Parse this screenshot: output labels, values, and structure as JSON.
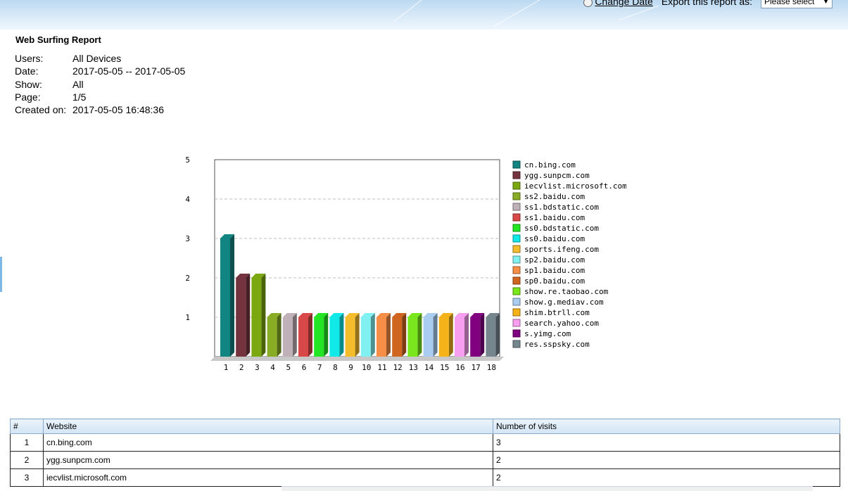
{
  "header": {
    "change_date_label": "Change Date",
    "export_label": "Export this report as:",
    "export_select_value": "Please select"
  },
  "report": {
    "title": "Web Surfing Report",
    "meta": [
      {
        "label": "Users:",
        "value": "All Devices"
      },
      {
        "label": "Date:",
        "value": "2017-05-05 -- 2017-05-05"
      },
      {
        "label": "Show:",
        "value": "All"
      },
      {
        "label": "Page:",
        "value": "1/5"
      },
      {
        "label": "Created on:",
        "value": "2017-05-05 16:48:36"
      }
    ]
  },
  "chart_data": {
    "type": "bar",
    "categories": [
      "1",
      "2",
      "3",
      "4",
      "5",
      "6",
      "7",
      "8",
      "9",
      "10",
      "11",
      "12",
      "13",
      "14",
      "15",
      "16",
      "17",
      "18"
    ],
    "values": [
      3,
      2,
      2,
      1,
      1,
      1,
      1,
      1,
      1,
      1,
      1,
      1,
      1,
      1,
      1,
      1,
      1,
      1
    ],
    "legend": [
      "cn.bing.com",
      "ygg.sunpcm.com",
      "iecvlist.microsoft.com",
      "ss2.baidu.com",
      "ss1.bdstatic.com",
      "ss1.baidu.com",
      "ss0.bdstatic.com",
      "ss0.baidu.com",
      "sports.ifeng.com",
      "sp2.baidu.com",
      "sp1.baidu.com",
      "sp0.baidu.com",
      "show.re.taobao.com",
      "show.g.mediav.com",
      "shim.btrll.com",
      "search.yahoo.com",
      "s.yimg.com",
      "res.sspsky.com"
    ],
    "colors": [
      "#128583",
      "#74333e",
      "#7ba711",
      "#88ac24",
      "#bfb1b7",
      "#d94848",
      "#22e623",
      "#11e8e8",
      "#f5bd2c",
      "#80f0f0",
      "#f68e48",
      "#d06520",
      "#7ae61c",
      "#a9cdf1",
      "#f5b319",
      "#f89ef0",
      "#800080",
      "#76868e"
    ],
    "yticks": [
      1,
      2,
      3,
      4,
      5
    ],
    "ylim": [
      0,
      5
    ],
    "grid": true,
    "legend_position": "right"
  },
  "table": {
    "headers": [
      "#",
      "Website",
      "Number of visits"
    ],
    "rows": [
      [
        "1",
        "cn.bing.com",
        "3"
      ],
      [
        "2",
        "ygg.sunpcm.com",
        "2"
      ],
      [
        "3",
        "iecvlist.microsoft.com",
        "2"
      ]
    ]
  }
}
